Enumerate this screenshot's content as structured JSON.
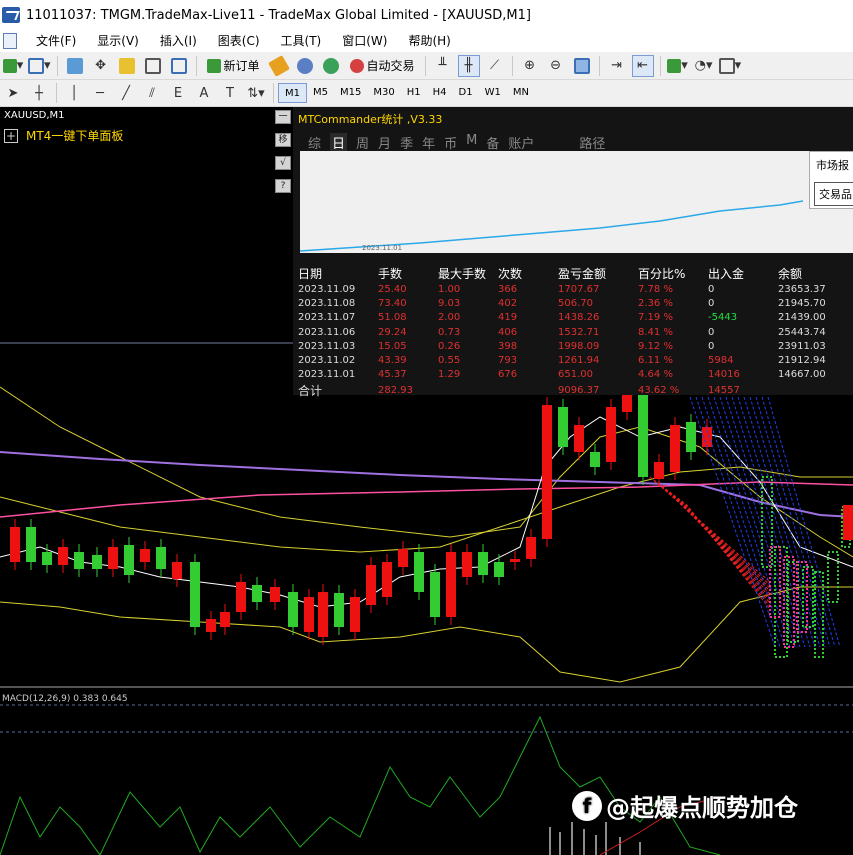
{
  "window": {
    "title": "11011037: TMGM.TradeMax-Live11 - TradeMax Global Limited - [XAUUSD,M1]"
  },
  "menu": [
    "文件(F)",
    "显示(V)",
    "插入(I)",
    "图表(C)",
    "工具(T)",
    "窗口(W)",
    "帮助(H)"
  ],
  "toolbar": {
    "new_order": "新订单",
    "auto_trade": "自动交易"
  },
  "drawing_tools": {
    "fib_label": "E",
    "text_label": "A",
    "text_box_label": "T"
  },
  "timeframes": [
    "M1",
    "M5",
    "M15",
    "M30",
    "H1",
    "H4",
    "D1",
    "W1",
    "MN"
  ],
  "active_timeframe": "M1",
  "chart": {
    "symbol": "XAUUSD,M1",
    "panel_button": "MT4一键下单面板",
    "side_buttons": [
      "一",
      "移",
      "√",
      "?"
    ]
  },
  "mtcommander": {
    "title": "MTCommander统计 ,V3.33",
    "tabs": [
      "综",
      "日",
      "周",
      "月",
      "季",
      "年",
      "币",
      "M",
      "备",
      "账户",
      "路径"
    ],
    "active_tab": "日",
    "graph_date": "2023.11.01",
    "popup": {
      "item1": "市场报",
      "item2": "交易品"
    },
    "columns": [
      "日期",
      "手数",
      "最大手数",
      "次数",
      "盈亏金额",
      "百分比%",
      "出入金",
      "余额"
    ],
    "rows": [
      [
        "2023.11.09",
        "25.40",
        "1.00",
        "366",
        "1707.67",
        "7.78 %",
        "0",
        "23653.37"
      ],
      [
        "2023.11.08",
        "73.40",
        "9.03",
        "402",
        "506.70",
        "2.36 %",
        "0",
        "21945.70"
      ],
      [
        "2023.11.07",
        "51.08",
        "2.00",
        "419",
        "1438.26",
        "7.19 %",
        "-5443",
        "21439.00"
      ],
      [
        "2023.11.06",
        "29.24",
        "0.73",
        "406",
        "1532.71",
        "8.41 %",
        "0",
        "25443.74"
      ],
      [
        "2023.11.03",
        "15.05",
        "0.26",
        "398",
        "1998.09",
        "9.12 %",
        "0",
        "23911.03"
      ],
      [
        "2023.11.02",
        "43.39",
        "0.55",
        "793",
        "1261.94",
        "6.11 %",
        "5984",
        "21912.94"
      ],
      [
        "2023.11.01",
        "45.37",
        "1.29",
        "676",
        "651.00",
        "4.64 %",
        "14016",
        "14667.00"
      ]
    ],
    "total": [
      "合计",
      "282.93",
      "",
      "",
      "9096.37",
      "43.62 %",
      "14557",
      ""
    ]
  },
  "macd": {
    "label": "MACD(12,26,9) 0.383 0.645"
  },
  "watermark": {
    "text": "@起爆点顺势加仓"
  },
  "colors": {
    "chart_bg": "#000000",
    "bull": "#33cc33",
    "bear": "#ee1111",
    "title_yellow": "#ffd700",
    "mtc_line": "#2aa8e8",
    "macd_line": "#22aa22"
  }
}
